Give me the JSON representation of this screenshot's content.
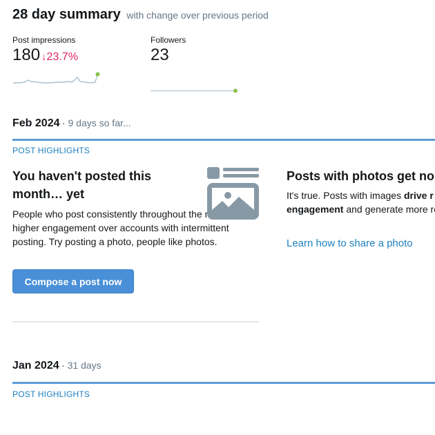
{
  "summary": {
    "title": "28 day summary",
    "subtitle": "with change over previous period",
    "impressions": {
      "label": "Post impressions",
      "value": "180",
      "change": "23.7%",
      "trend": "down",
      "color": "#e0245e"
    },
    "followers": {
      "label": "Followers",
      "value": "23"
    },
    "sparkline_color": "#9cb5c8",
    "sparkline_endpoint_color": "#8bc34a"
  },
  "months": [
    {
      "title": "Feb 2024",
      "separator": "·",
      "subtitle": "9 days so far...",
      "section_label": "POST HIGHLIGHTS",
      "card_no_posts": {
        "title": "You haven't posted this month… yet",
        "body": "People who post consistently throughout the month get higher engagement over accounts with intermittent posting. Try posting a photo, people like photos.",
        "button": "Compose a post now",
        "icon": "photo-post-icon"
      },
      "card_photos": {
        "title": "Posts with photos get no",
        "body_prefix": "It's true. Posts with images ",
        "body_bold_1": "drive r",
        "body_bold_2": "engagement",
        "body_suffix": " and generate more responses.",
        "link": "Learn how to share a photo"
      }
    },
    {
      "title": "Jan 2024",
      "separator": "·",
      "subtitle": "31 days",
      "section_label": "POST HIGHLIGHTS"
    }
  ],
  "colors": {
    "accent": "#5b9bd5",
    "link": "#1b7fbd",
    "button": "#4a90d9",
    "icon_gray": "#8899a6"
  }
}
